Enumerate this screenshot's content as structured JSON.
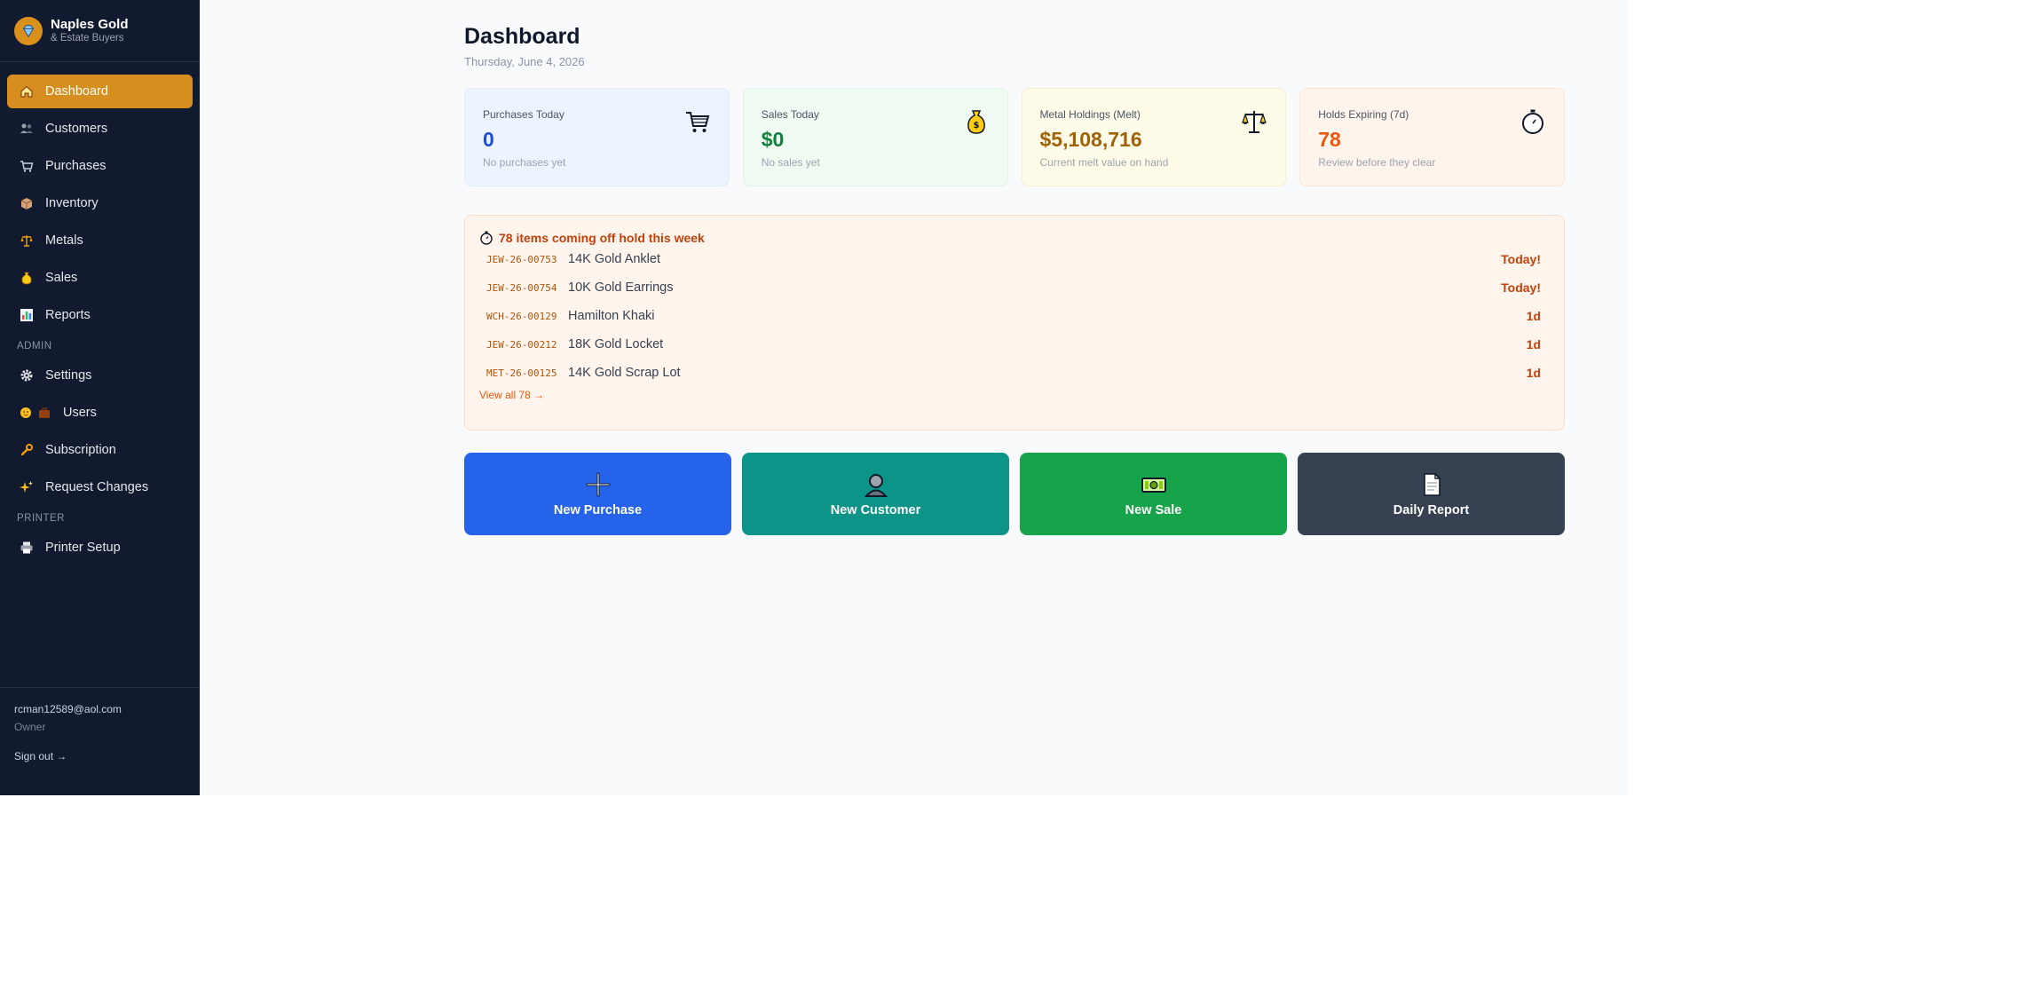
{
  "brand": {
    "name": "Naples Gold",
    "subtitle": "& Estate Buyers",
    "accent": "#d68f1f"
  },
  "sidebar": {
    "items": [
      {
        "label": "Dashboard",
        "icon": "home-icon",
        "active": true
      },
      {
        "label": "Customers",
        "icon": "people-icon"
      },
      {
        "label": "Purchases",
        "icon": "cart-icon"
      },
      {
        "label": "Inventory",
        "icon": "box-icon"
      },
      {
        "label": "Metals",
        "icon": "scales-icon"
      },
      {
        "label": "Sales",
        "icon": "money-bag-icon"
      },
      {
        "label": "Reports",
        "icon": "bar-chart-icon"
      }
    ],
    "admin_section": "ADMIN",
    "admin_items": [
      {
        "label": "Settings",
        "icon": "gear-icon"
      },
      {
        "label": "Users",
        "icon": "users-icon"
      },
      {
        "label": "Subscription",
        "icon": "wrench-icon"
      },
      {
        "label": "Request Changes",
        "icon": "sparkles-icon"
      }
    ],
    "printer_section": "PRINTER",
    "printer_items": [
      {
        "label": "Printer Setup",
        "icon": "printer-icon"
      }
    ],
    "footer": {
      "email": "rcman12589@aol.com",
      "role": "Owner",
      "signout": "Sign out →"
    }
  },
  "header": {
    "title": "Dashboard",
    "date": "Thursday, June 4, 2026"
  },
  "cards": [
    {
      "label": "Purchases Today",
      "value": "0",
      "sub": "No purchases yet",
      "icon": "cart-icon"
    },
    {
      "label": "Sales Today",
      "value": "$0",
      "sub": "No sales yet",
      "icon": "money-bag-icon"
    },
    {
      "label": "Metal Holdings (Melt)",
      "value": "$5,108,716",
      "sub": "Current melt value on hand",
      "icon": "scales-icon"
    },
    {
      "label": "Holds Expiring (7d)",
      "value": "78",
      "sub": "Review before they clear",
      "icon": "stopwatch-icon"
    }
  ],
  "holds": {
    "title": "78 items coming off hold this week",
    "rows": [
      {
        "code": "JEW-26-00753",
        "name": "14K Gold Anklet",
        "days": "Today!"
      },
      {
        "code": "JEW-26-00754",
        "name": "10K Gold Earrings",
        "days": "Today!"
      },
      {
        "code": "WCH-26-00129",
        "name": "Hamilton Khaki",
        "days": "1d"
      },
      {
        "code": "JEW-26-00212",
        "name": "18K Gold Locket",
        "days": "1d"
      },
      {
        "code": "MET-26-00125",
        "name": "14K Gold Scrap Lot",
        "days": "1d"
      }
    ],
    "view_all": "View all 78 →"
  },
  "actions": [
    {
      "label": "New Purchase",
      "icon": "plus-icon",
      "color": "#2563eb"
    },
    {
      "label": "New Customer",
      "icon": "person-icon",
      "color": "#0d9488"
    },
    {
      "label": "New Sale",
      "icon": "cash-icon",
      "color": "#16a34a"
    },
    {
      "label": "Daily Report",
      "icon": "document-icon",
      "color": "#374151"
    }
  ]
}
